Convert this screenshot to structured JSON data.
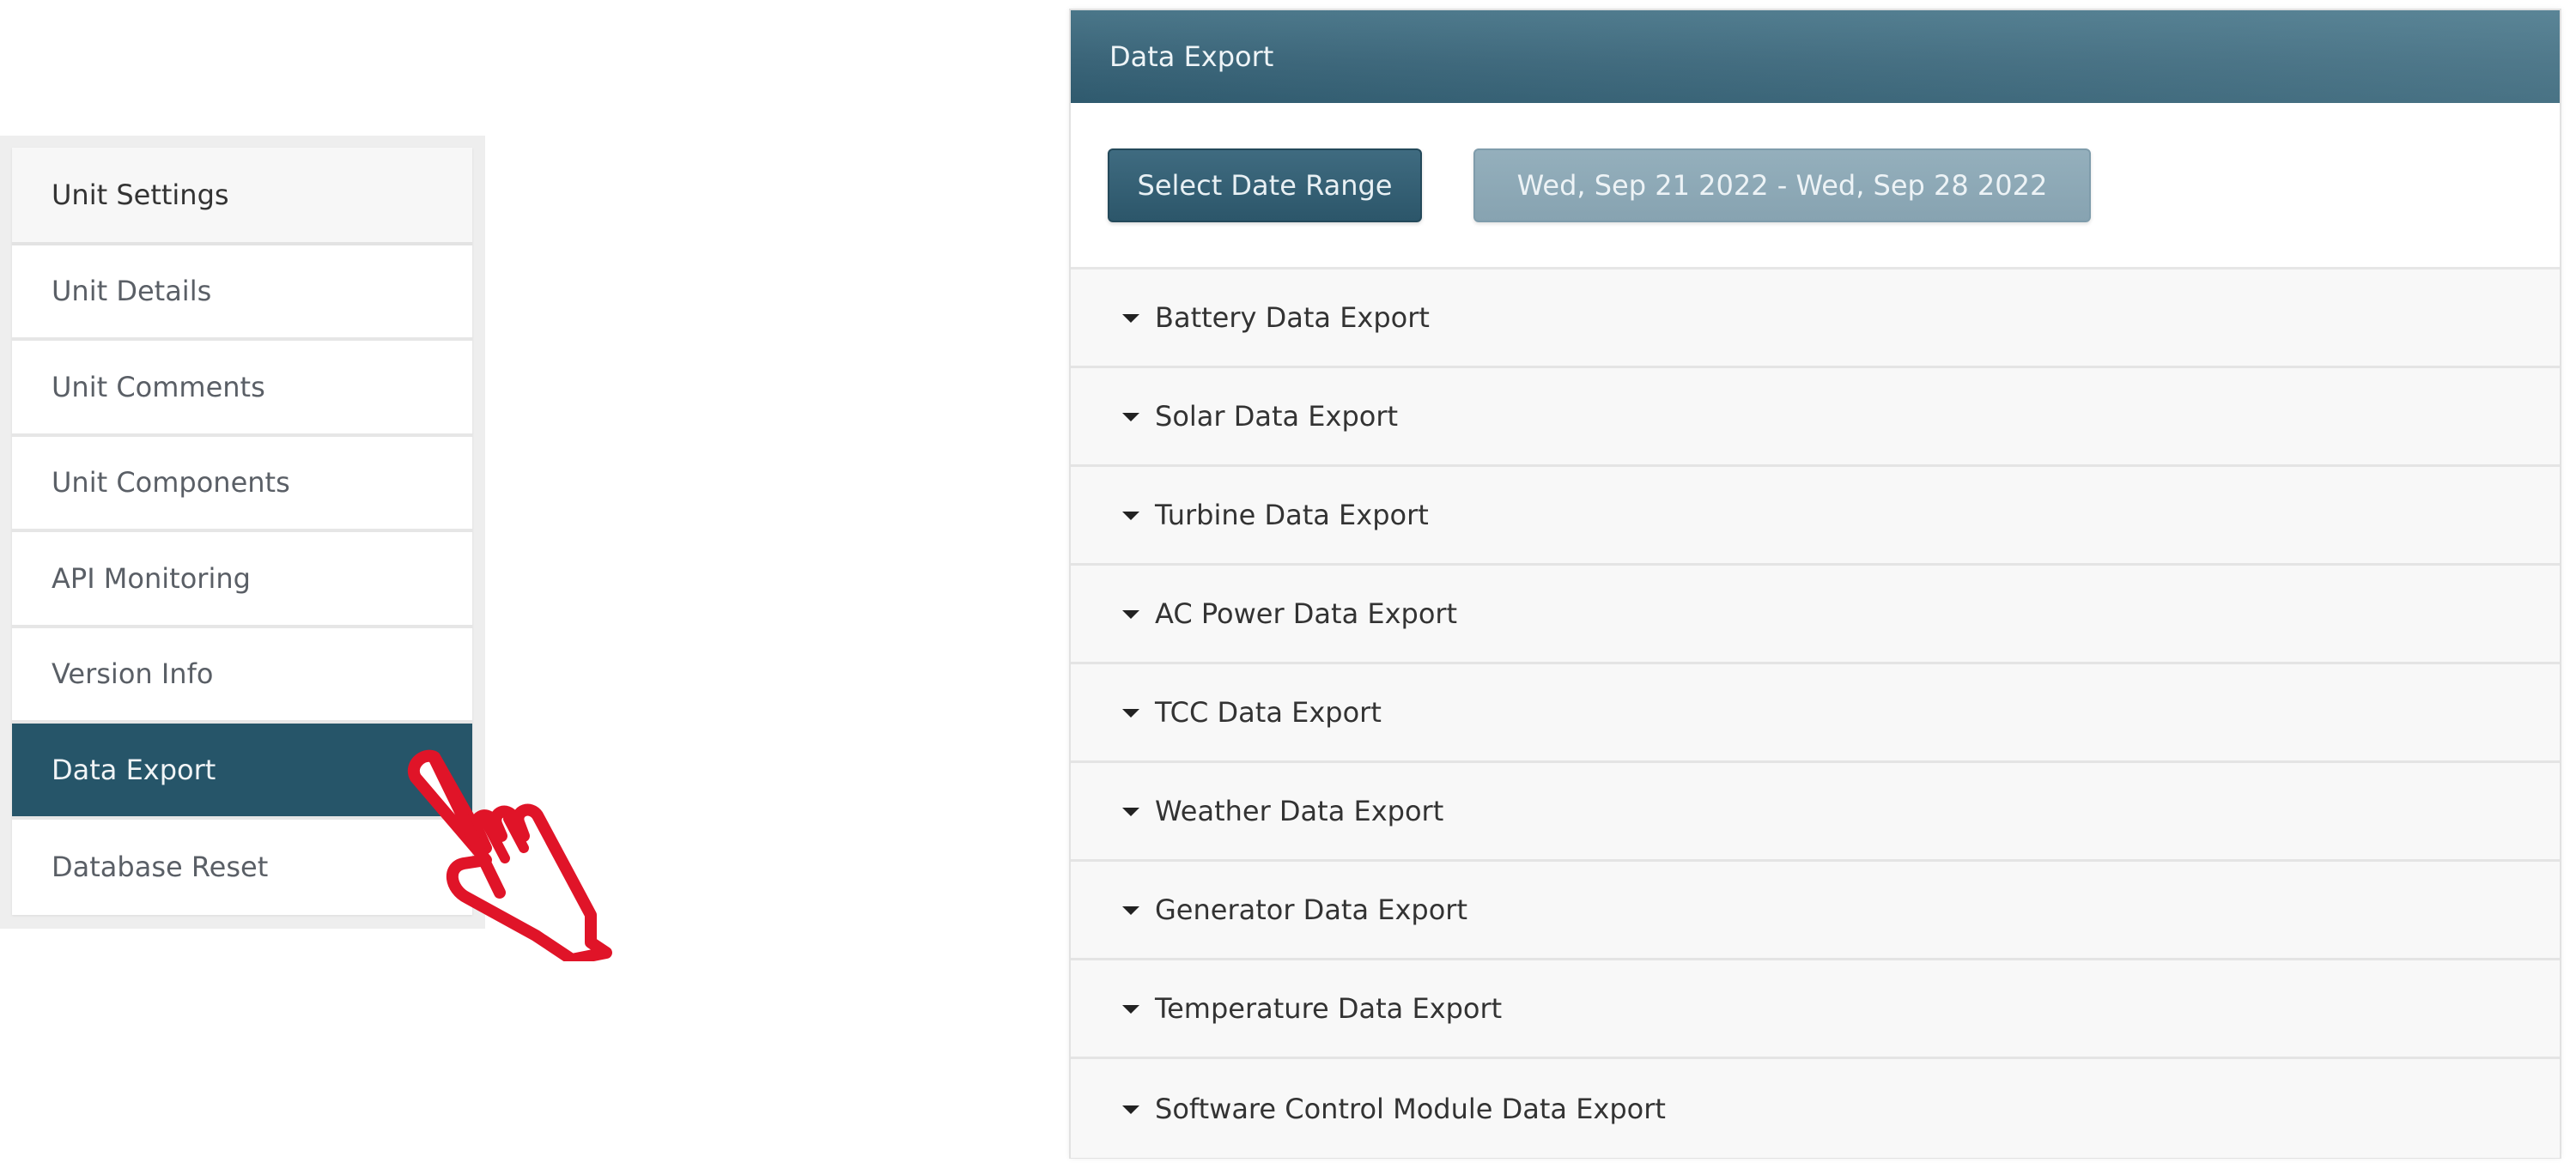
{
  "sidebar": {
    "title": "Unit Settings",
    "items": [
      {
        "label": "Unit Details",
        "active": false
      },
      {
        "label": "Unit Comments",
        "active": false
      },
      {
        "label": "Unit Components",
        "active": false
      },
      {
        "label": "API Monitoring",
        "active": false
      },
      {
        "label": "Version Info",
        "active": false
      },
      {
        "label": "Data Export",
        "active": true
      },
      {
        "label": "Database Reset",
        "active": false
      }
    ]
  },
  "cursor": {
    "icon": "pointing-hand-icon",
    "color": "#e01428"
  },
  "panel": {
    "title": "Data Export",
    "select_range_label": "Select Date Range",
    "date_range_value": "Wed, Sep 21 2022 - Wed, Sep 28 2022",
    "sections": [
      {
        "label": "Battery Data Export",
        "icon": "caret-down-icon"
      },
      {
        "label": "Solar Data Export",
        "icon": "caret-down-icon"
      },
      {
        "label": "Turbine Data Export",
        "icon": "caret-down-icon"
      },
      {
        "label": "AC Power Data Export",
        "icon": "caret-down-icon"
      },
      {
        "label": "TCC Data Export",
        "icon": "caret-down-icon"
      },
      {
        "label": "Weather Data Export",
        "icon": "caret-down-icon"
      },
      {
        "label": "Generator Data Export",
        "icon": "caret-down-icon"
      },
      {
        "label": "Temperature Data Export",
        "icon": "caret-down-icon"
      },
      {
        "label": "Software Control Module Data Export",
        "icon": "caret-down-icon"
      }
    ]
  },
  "colors": {
    "accent": "#265569",
    "header": "#3a6478",
    "date_button": "#8aa7b4",
    "cursor": "#e01428"
  }
}
